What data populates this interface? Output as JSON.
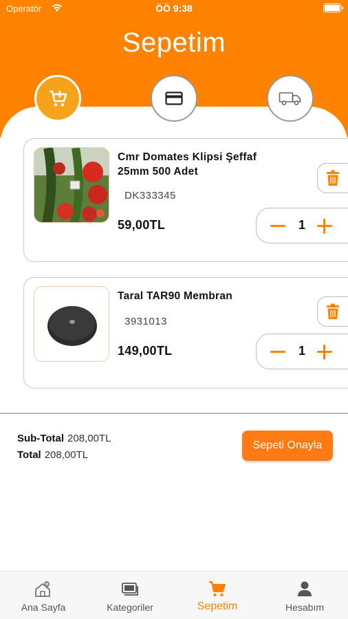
{
  "status_bar": {
    "carrier": "Operatör",
    "time": "ÖÖ 9:38"
  },
  "header": {
    "title": "Sepetim"
  },
  "steps": [
    {
      "name": "cart",
      "icon": "cart-plus-icon",
      "active": true
    },
    {
      "name": "payment",
      "icon": "credit-card-icon",
      "active": false
    },
    {
      "name": "delivery",
      "icon": "truck-icon",
      "active": false
    }
  ],
  "cart": {
    "items": [
      {
        "name": "Cmr Domates Klipsi Şeffaf 25mm 500 Adet",
        "code": "DK333345",
        "price": "59,00TL",
        "quantity": "1"
      },
      {
        "name": "Taral TAR90 Membran",
        "code": "3931013",
        "price": "149,00TL",
        "quantity": "1"
      }
    ]
  },
  "summary": {
    "subtotal_label": "Sub-Total",
    "subtotal_value": "208,00TL",
    "total_label": "Total",
    "total_value": "208,00TL",
    "confirm_label": "Sepeti Onayla"
  },
  "tabbar": {
    "items": [
      {
        "label": "Ana Sayfa",
        "icon": "home-location-icon"
      },
      {
        "label": "Kategoriler",
        "icon": "categories-icon"
      },
      {
        "label": "Sepetim",
        "icon": "cart-icon",
        "active": true
      },
      {
        "label": "Hesabım",
        "icon": "user-icon"
      }
    ]
  },
  "colors": {
    "accent": "#ff8200",
    "step_active": "#f7a21b",
    "confirm_button": "#ff7a14",
    "delete_icon": "#ff8200"
  }
}
